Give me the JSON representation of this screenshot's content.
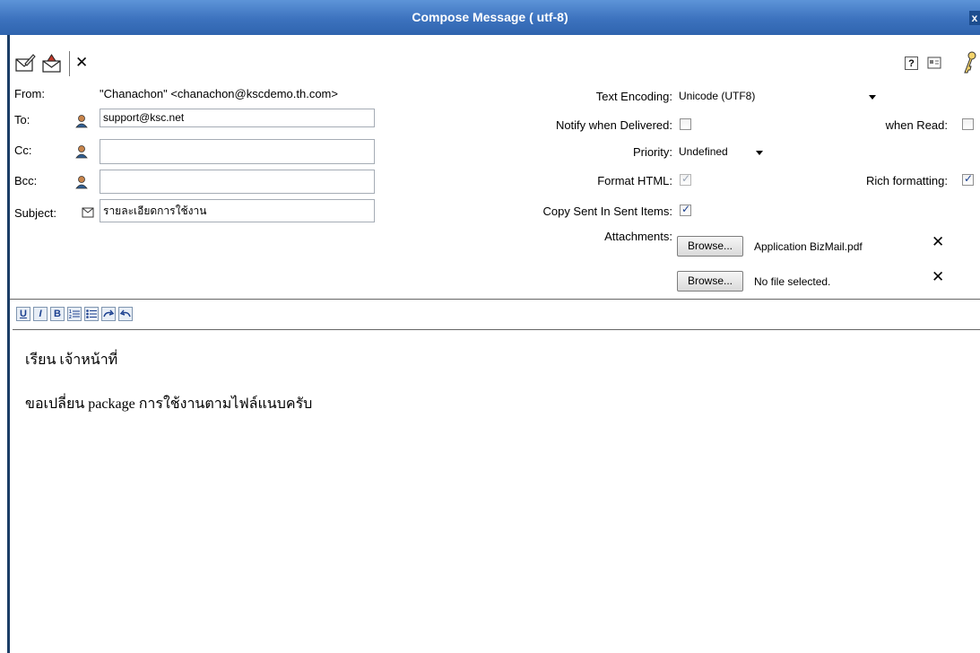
{
  "window": {
    "title": "Compose Message ( utf-8)",
    "close_label": "x"
  },
  "toolbar": {
    "send_icon": "envelope-pen-icon",
    "send_later_icon": "envelope-arrow-icon",
    "cancel_label": "✕",
    "help_label": "?",
    "address_icon": "address-book-icon",
    "options_icon": "key-icon"
  },
  "header": {
    "from_label": "From:",
    "from_value": "\"Chanachon\" <chanachon@kscdemo.th.com>",
    "to_label": "To:",
    "to_value": "support@ksc.net",
    "cc_label": "Cc:",
    "cc_value": "",
    "bcc_label": "Bcc:",
    "bcc_value": "",
    "subject_label": "Subject:",
    "subject_value": "รายละเอียดการใช้งาน"
  },
  "options": {
    "encoding_label": "Text Encoding:",
    "encoding_value": "Unicode (UTF8)",
    "notify_delivered_label": "Notify when Delivered:",
    "when_read_label": "when Read:",
    "priority_label": "Priority:",
    "priority_value": "Undefined",
    "format_html_label": "Format HTML:",
    "rich_formatting_label": "Rich formatting:",
    "copy_sent_label": "Copy Sent In Sent Items:",
    "attachments_label": "Attachments:",
    "browse_label": "Browse...",
    "attachment_1": "Application BizMail.pdf",
    "attachment_2": "No file selected.",
    "remove_label": "✕"
  },
  "checkbox_states": {
    "notify_delivered": false,
    "when_read": false,
    "format_html": true,
    "rich_formatting": true,
    "copy_sent": true
  },
  "format_toolbar": {
    "underline": "U",
    "italic": "I",
    "bold": "B"
  },
  "body": {
    "line1": "เรียน เจ้าหน้าที่",
    "line2": "ขอเปลี่ยน package การใช้งานตามไฟล์แนบครับ"
  }
}
